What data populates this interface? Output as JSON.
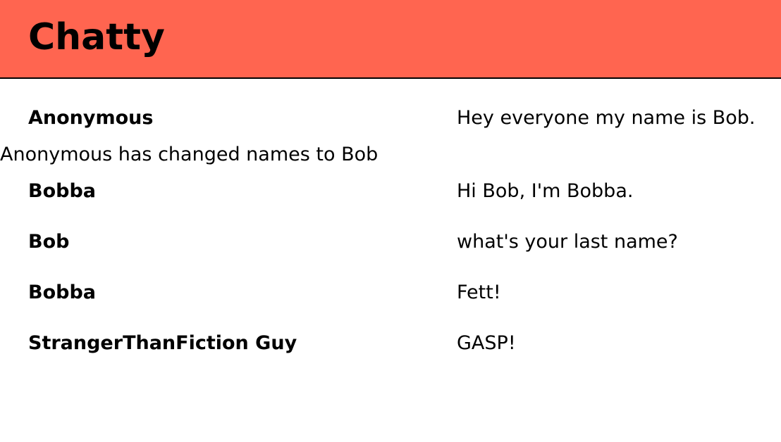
{
  "header": {
    "title": "Chatty"
  },
  "messages": [
    {
      "type": "message",
      "username": "Anonymous",
      "content": "Hey everyone my name is Bob."
    },
    {
      "type": "notification",
      "content": "Anonymous has changed names to Bob"
    },
    {
      "type": "message",
      "username": "Bobba",
      "content": "Hi Bob, I'm Bobba."
    },
    {
      "type": "message",
      "username": "Bob",
      "content": "what's your last name?"
    },
    {
      "type": "message",
      "username": "Bobba",
      "content": "Fett!"
    },
    {
      "type": "message",
      "username": "StrangerThanFiction Guy",
      "content": "GASP!"
    }
  ],
  "colors": {
    "navbar_background": "#ff6550",
    "navbar_border": "#000000",
    "text": "#000000",
    "page_background": "#ffffff"
  }
}
